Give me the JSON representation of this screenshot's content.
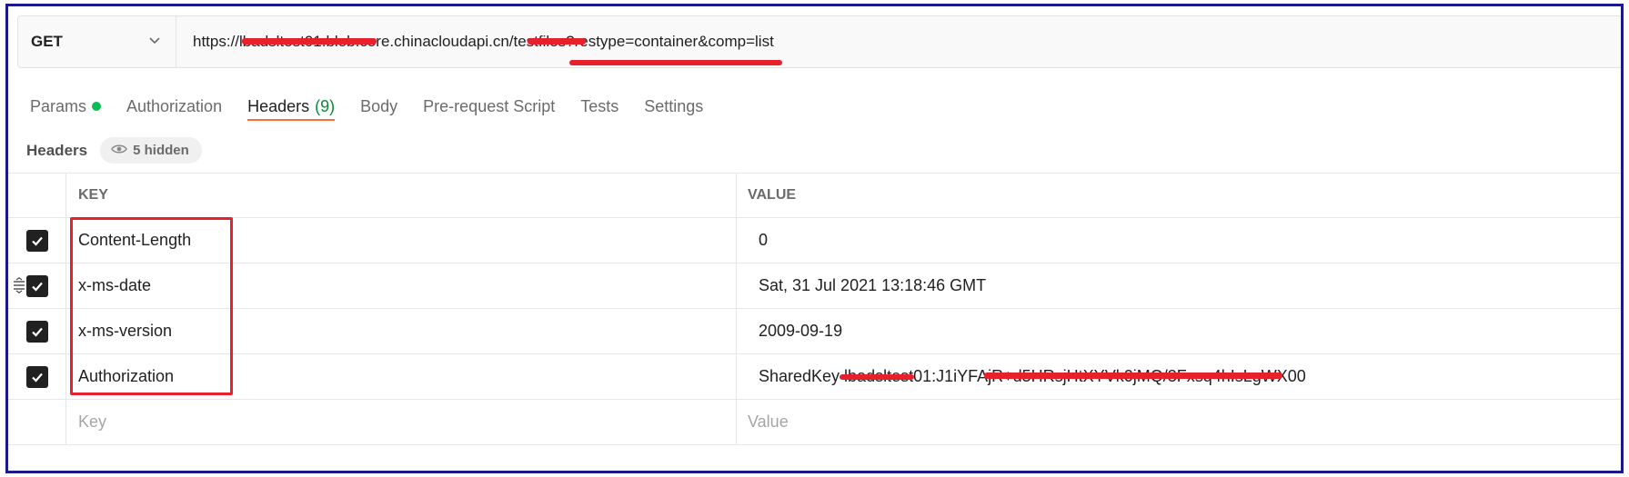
{
  "request": {
    "method": "GET",
    "url": "https://lbadsltest01.blob.core.chinacloudapi.cn/testfiles?restype=container&comp=list"
  },
  "tabs": [
    {
      "label": "Params",
      "count": "",
      "dot": true
    },
    {
      "label": "Authorization",
      "count": "",
      "dot": false
    },
    {
      "label": "Headers",
      "count": "(9)",
      "dot": false,
      "active": true
    },
    {
      "label": "Body",
      "count": "",
      "dot": false
    },
    {
      "label": "Pre-request Script",
      "count": "",
      "dot": false
    },
    {
      "label": "Tests",
      "count": "",
      "dot": false
    },
    {
      "label": "Settings",
      "count": "",
      "dot": false
    }
  ],
  "headers_section": {
    "title": "Headers",
    "hidden_label": "5 hidden"
  },
  "table": {
    "columns": {
      "key": "KEY",
      "value": "VALUE"
    },
    "rows": [
      {
        "key": "Content-Length",
        "value": "0",
        "checked": true
      },
      {
        "key": "x-ms-date",
        "value": "Sat, 31 Jul 2021 13:18:46 GMT",
        "checked": true
      },
      {
        "key": "x-ms-version",
        "value": "2009-09-19",
        "checked": true
      },
      {
        "key": "Authorization",
        "value": "SharedKey lbadsltest01:J1iYFAjR+d5HRsjHtXYVk0jMQ/3Fxsq4hIsLgWX00",
        "checked": true
      }
    ],
    "placeholder": {
      "key": "Key",
      "value": "Value"
    }
  },
  "colors": {
    "accent_tab": "#ff6c37",
    "params_dot": "#0cbb52",
    "annotation_red": "#e8202b",
    "frame_border": "#1a1a8c"
  }
}
